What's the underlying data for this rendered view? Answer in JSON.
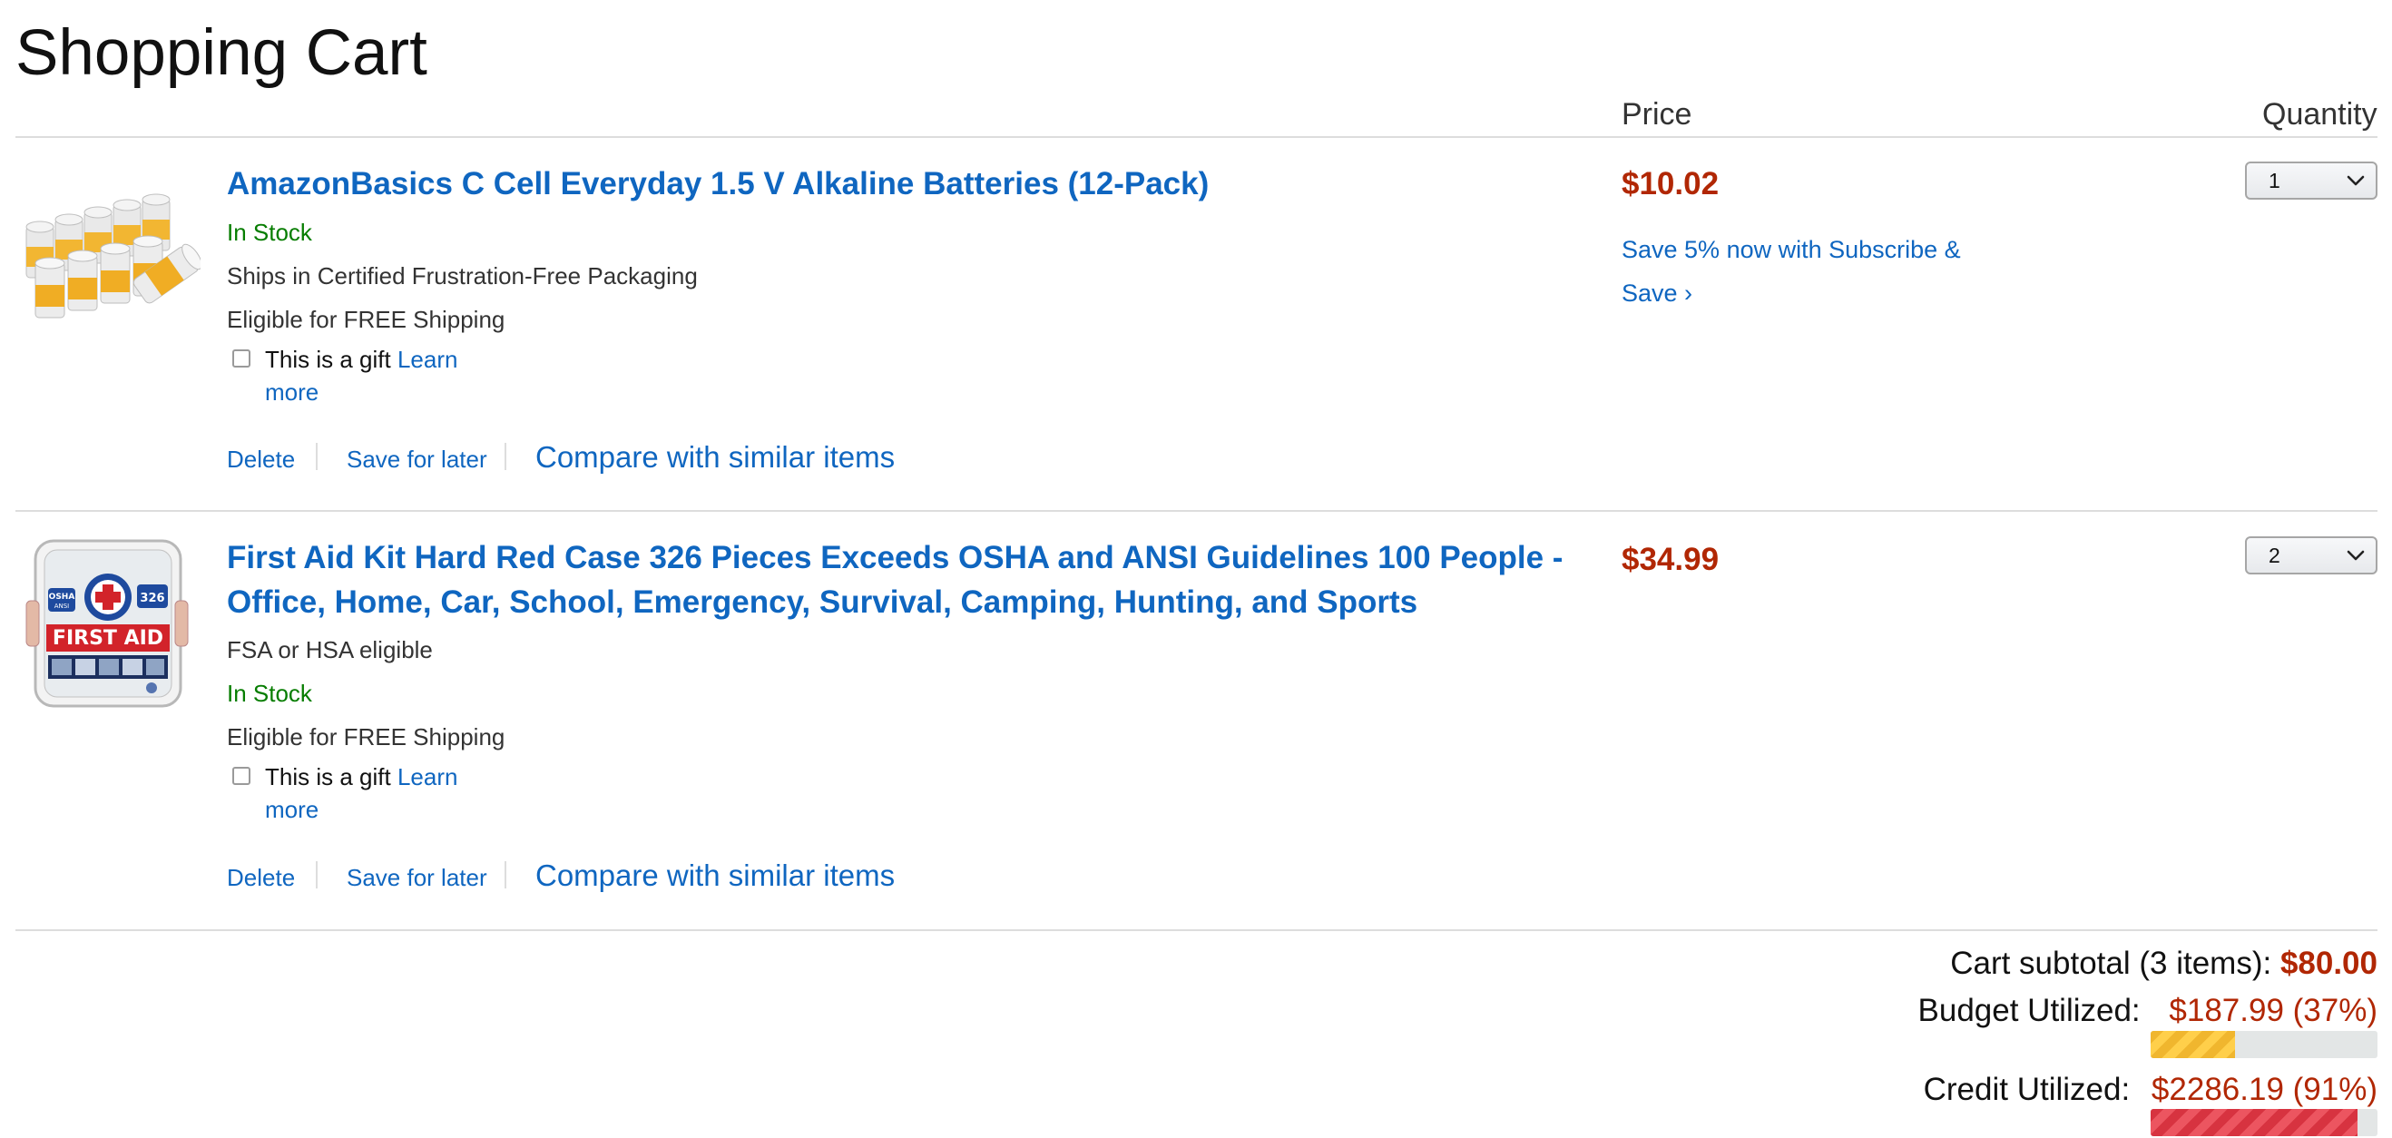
{
  "page": {
    "title": "Shopping Cart"
  },
  "columns": {
    "price": "Price",
    "quantity": "Quantity"
  },
  "items": [
    {
      "title": "AmazonBasics C Cell Everyday 1.5 V Alkaline Batteries (12-Pack)",
      "stock": "In Stock",
      "packaging": "Ships in Certified Frustration-Free Packaging",
      "shipping": "Eligible for FREE Shipping",
      "gift_label": "This is a gift",
      "learn_more_1": "Learn",
      "learn_more_2": "more",
      "delete_label": "Delete",
      "save_later_label": "Save for later",
      "compare_label": "Compare with similar items",
      "price": "$10.02",
      "subscribe_line1": "Save 5% now with Subscribe &",
      "subscribe_line2": "Save ›",
      "quantity": "1",
      "thumbnail_icon": "batteries-product-image"
    },
    {
      "title": "First Aid Kit Hard Red Case 326 Pieces Exceeds OSHA and ANSI Guidelines 100 People - Office, Home, Car, School, Emergency, Survival, Camping, Hunting, and Sports",
      "fsa": "FSA or HSA eligible",
      "stock": "In Stock",
      "shipping": "Eligible for FREE Shipping",
      "gift_label": "This is a gift",
      "learn_more_1": "Learn",
      "learn_more_2": "more",
      "delete_label": "Delete",
      "save_later_label": "Save for later",
      "compare_label": "Compare with similar items",
      "price": "$34.99",
      "quantity": "2",
      "thumbnail_icon": "first-aid-kit-product-image",
      "thumbnail_text": {
        "badge": "326",
        "osha": "OSHA",
        "ansi": "ANSI",
        "banner": "FIRST AID"
      }
    }
  ],
  "summary": {
    "subtotal_label": "Cart subtotal (3 items):",
    "subtotal_value": "$80.00",
    "budget_label": "Budget Utilized:",
    "budget_value": "$187.99 (37%)",
    "budget_fraction": 0.37,
    "credit_label": "Credit Utilized:",
    "credit_value": "$2286.19 (91%)",
    "credit_fraction": 0.91
  },
  "colors": {
    "link": "#0f66c0",
    "price": "#b12704",
    "in_stock": "#067d00",
    "budget_bar": "#f0b62e",
    "credit_bar": "#d73340"
  }
}
